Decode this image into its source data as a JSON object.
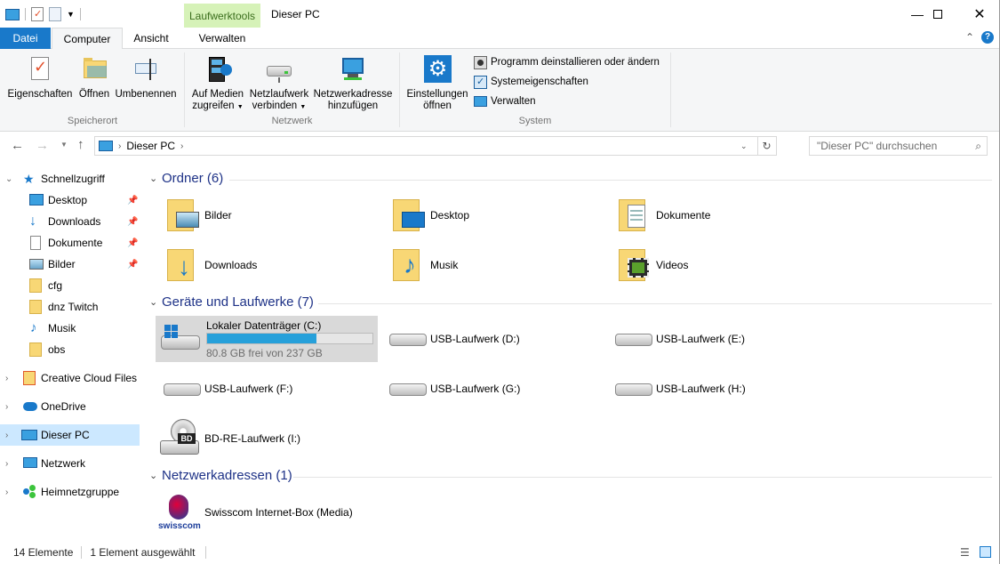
{
  "window": {
    "title": "Dieser PC",
    "context_tab": "Laufwerktools"
  },
  "tabs": {
    "datei": "Datei",
    "computer": "Computer",
    "ansicht": "Ansicht",
    "verwalten": "Verwalten"
  },
  "ribbon": {
    "speicherort": {
      "label": "Speicherort",
      "eigenschaften": "Eigenschaften",
      "oeffnen": "Öffnen",
      "umbenennen": "Umbenennen"
    },
    "netzwerk": {
      "label": "Netzwerk",
      "medien_l1": "Auf Medien",
      "medien_l2": "zugreifen",
      "laufwerk_l1": "Netzlaufwerk",
      "laufwerk_l2": "verbinden",
      "adresse_l1": "Netzwerkadresse",
      "adresse_l2": "hinzufügen"
    },
    "system": {
      "label": "System",
      "einst_l1": "Einstellungen",
      "einst_l2": "öffnen",
      "programm": "Programm deinstallieren oder ändern",
      "systemeig": "Systemeigenschaften",
      "verwalten": "Verwalten"
    }
  },
  "address": {
    "path": "Dieser PC",
    "search_placeholder": "\"Dieser PC\" durchsuchen"
  },
  "sidebar": {
    "quick": "Schnellzugriff",
    "items": [
      "Desktop",
      "Downloads",
      "Dokumente",
      "Bilder",
      "cfg",
      "dnz Twitch",
      "Musik",
      "obs"
    ],
    "creative": "Creative Cloud Files",
    "onedrive": "OneDrive",
    "dieserpc": "Dieser PC",
    "netzwerk": "Netzwerk",
    "heimnetz": "Heimnetzgruppe"
  },
  "sections": {
    "ordner": "Ordner (6)",
    "geraete": "Geräte und Laufwerke (7)",
    "netzadr": "Netzwerkadressen (1)"
  },
  "folders": [
    "Bilder",
    "Desktop",
    "Dokumente",
    "Downloads",
    "Musik",
    "Videos"
  ],
  "drives": {
    "c": {
      "name": "Lokaler Datenträger (C:)",
      "free": "80.8 GB frei von 237 GB",
      "used_fraction": 0.66
    },
    "d": "USB-Laufwerk (D:)",
    "e": "USB-Laufwerk (E:)",
    "f": "USB-Laufwerk (F:)",
    "g": "USB-Laufwerk (G:)",
    "h": "USB-Laufwerk (H:)",
    "i": "BD-RE-Laufwerk (I:)",
    "bd_badge": "BD"
  },
  "network_locations": {
    "swisscom": "Swisscom Internet-Box (Media)",
    "swisscom_logo": "swisscom"
  },
  "status": {
    "count": "14 Elemente",
    "selected": "1 Element ausgewählt"
  },
  "colors": {
    "accent": "#1979ca",
    "folder": "#f8d775",
    "selection": "#cce8ff",
    "drive_bar": "#26a0da"
  }
}
